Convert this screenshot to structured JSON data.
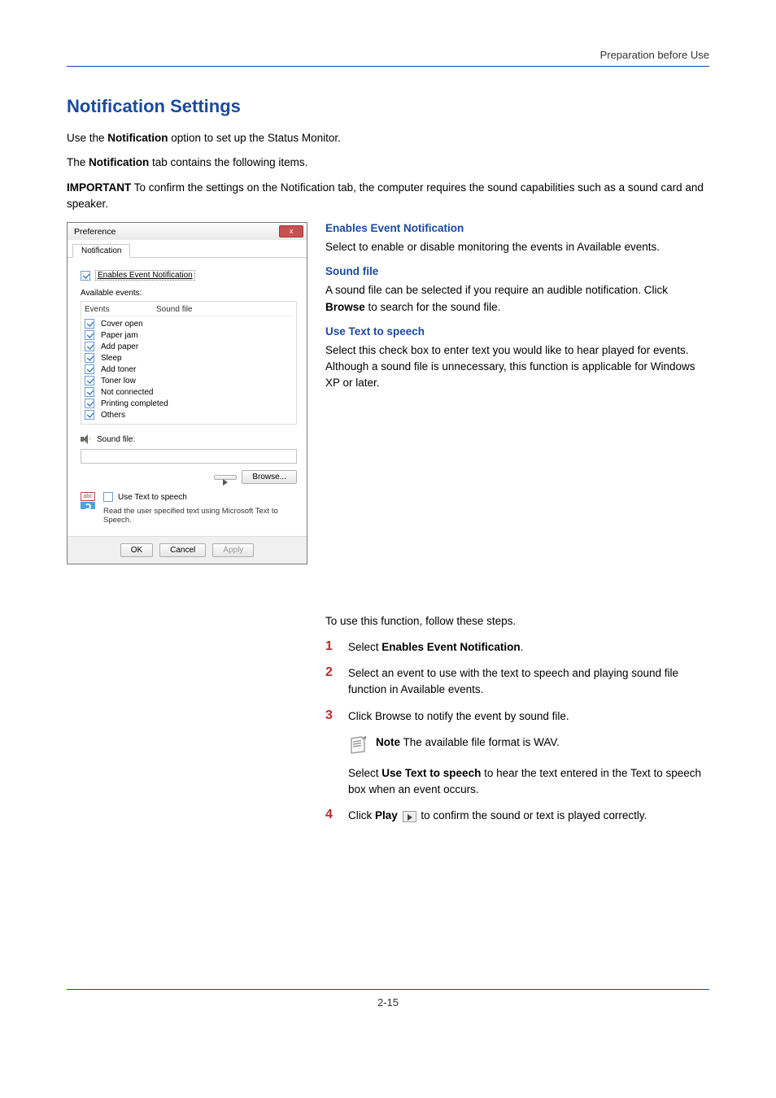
{
  "header": {
    "section": "Preparation before Use"
  },
  "title": "Notification Settings",
  "intro1_pre": "Use the ",
  "intro1_bold": "Notification",
  "intro1_post": " option to set up the Status Monitor.",
  "intro2_pre": "The ",
  "intro2_bold": "Notification",
  "intro2_post": " tab contains the following items.",
  "important_label": "IMPORTANT",
  "important_body": "  To confirm the settings on the Notification tab, the computer requires the sound capabilities such as a sound card and speaker.",
  "right": {
    "h1": "Enables Event Notification",
    "p1": "Select to enable or disable monitoring the events in Available events.",
    "h2": "Sound file",
    "p2_a": "A sound file can be selected if you require an audible notification. Click ",
    "p2_b": "Browse",
    "p2_c": " to search for the sound file.",
    "h3": "Use Text to speech",
    "p3": "Select this check box to enter text you would like to hear played for events. Although a sound file is unnecessary, this function is applicable for Windows XP or later."
  },
  "steps_intro": "To use this function, follow these steps.",
  "steps": {
    "s1_a": "Select ",
    "s1_b": "Enables Event Notification",
    "s1_c": ".",
    "s2": "Select an event to use with the text to speech and playing sound file function in Available events.",
    "s3": "Click Browse to notify the event by sound file.",
    "note_label": "Note",
    "note_body": "  The available file format is WAV.",
    "post3_a": "Select ",
    "post3_b": "Use Text to speech",
    "post3_c": " to hear the text entered in the Text to speech box when an event occurs.",
    "s4_a": "Click ",
    "s4_b": "Play",
    "s4_c": " to confirm the sound or text is played correctly."
  },
  "win": {
    "title": "Preference",
    "close": "x",
    "tab": "Notification",
    "enable_chk": "Enables Event Notification",
    "avail": "Available events:",
    "col1": "Events",
    "col2": "Sound file",
    "events": {
      "e0": "Cover open",
      "e1": "Paper jam",
      "e2": "Add paper",
      "e3": "Sleep",
      "e4": "Add toner",
      "e5": "Toner low",
      "e6": "Not connected",
      "e7": "Printing completed",
      "e8": "Others"
    },
    "soundfile": "Sound file:",
    "browse": "Browse...",
    "tts_chk": "Use Text to speech",
    "tts_hint": "Read the user specified text using Microsoft Text to Speech.",
    "ok": "OK",
    "cancel": "Cancel",
    "apply": "Apply"
  },
  "footer": "2-15"
}
